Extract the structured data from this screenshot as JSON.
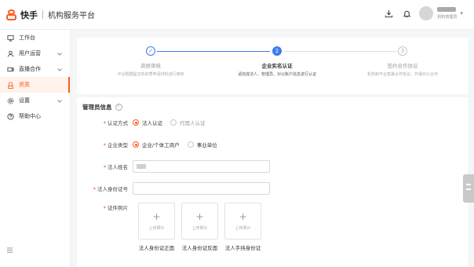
{
  "header": {
    "brand": "快手",
    "platform": "机构服务平台",
    "user_role": "机构管理员"
  },
  "sidebar": {
    "items": [
      {
        "label": "工作台",
        "icon": "monitor-icon",
        "has_children": false,
        "active": false
      },
      {
        "label": "用户运营",
        "icon": "users-icon",
        "has_children": true,
        "active": false
      },
      {
        "label": "直播合作",
        "icon": "live-icon",
        "has_children": true,
        "active": false
      },
      {
        "label": "资质",
        "icon": "badge-icon",
        "has_children": false,
        "active": true
      },
      {
        "label": "设置",
        "icon": "gear-icon",
        "has_children": true,
        "active": false
      },
      {
        "label": "帮助中心",
        "icon": "help-icon",
        "has_children": false,
        "active": false
      }
    ]
  },
  "steps": [
    {
      "index": "✓",
      "title": "资质审核",
      "desc": "平台根据提交的资质申请材料进行审核",
      "state": "done"
    },
    {
      "index": "2",
      "title": "企业实名认证",
      "desc": "请完成法人、管理员、对公账户信息进行认证",
      "state": "current"
    },
    {
      "index": "3",
      "title": "签约合作协议",
      "desc": "机构和平台签署合作协议，开通对公合作",
      "state": "pending"
    }
  ],
  "colors": {
    "accent": "#ff5a1f",
    "step_blue": "#3b7cf2",
    "required": "#f04040"
  },
  "form": {
    "section_title": "管理员信息",
    "auth_method": {
      "label": "认证方式",
      "options": [
        "法人认证",
        "代理人认证"
      ],
      "selected": "法人认证"
    },
    "company_type": {
      "label": "企业类型",
      "options": [
        "企业/个体工商户",
        "事业单位"
      ],
      "selected": "企业/个体工商户"
    },
    "legal_name": {
      "label": "法人姓名"
    },
    "legal_id": {
      "label": "法人身份证号"
    },
    "documents": {
      "label": "证件照片",
      "upload_text": "上传照片",
      "items": [
        "法人身份证正面",
        "法人身份证反面",
        "法人手持身份证"
      ]
    }
  }
}
